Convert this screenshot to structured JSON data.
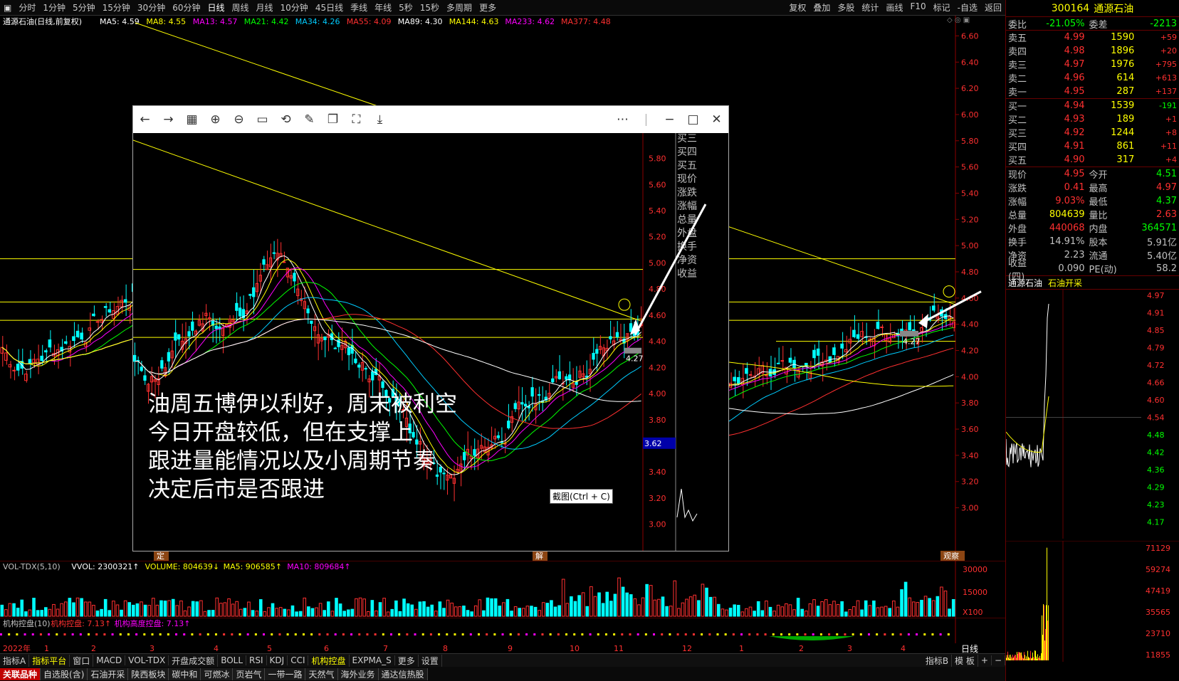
{
  "toolbar": {
    "periods": [
      "分时",
      "1分钟",
      "5分钟",
      "15分钟",
      "30分钟",
      "60分钟",
      "日线",
      "周线",
      "月线",
      "10分钟",
      "45日线",
      "季线",
      "年线",
      "5秒",
      "15秒",
      "多周期",
      "更多"
    ],
    "active": "日线",
    "right": [
      "复权",
      "叠加",
      "多股",
      "统计",
      "画线",
      "F10",
      "标记",
      "-自选",
      "返回"
    ]
  },
  "chart": {
    "title": "通源石油(日线,前复权)",
    "mas": [
      {
        "t": "MA5: 4.59",
        "c": "#ffffff"
      },
      {
        "t": "MA8: 4.55",
        "c": "#ffff00"
      },
      {
        "t": "MA13: 4.57",
        "c": "#ff00ff"
      },
      {
        "t": "MA21: 4.42",
        "c": "#00ff00"
      },
      {
        "t": "MA34: 4.26",
        "c": "#00ccff"
      },
      {
        "t": "MA55: 4.09",
        "c": "#ff3030"
      },
      {
        "t": "MA89: 4.30",
        "c": "#ffffff"
      },
      {
        "t": "MA144: 4.63",
        "c": "#ffff00"
      },
      {
        "t": "MA233: 4.62",
        "c": "#ff00ff"
      },
      {
        "t": "MA377: 4.48",
        "c": "#ff3030"
      }
    ],
    "yticks": [
      "6.60",
      "6.40",
      "6.20",
      "6.00",
      "5.80",
      "5.60",
      "5.40",
      "5.20",
      "5.00",
      "4.80",
      "4.60",
      "4.40",
      "4.20",
      "4.00",
      "3.80",
      "3.60",
      "3.40",
      "3.20",
      "3.00"
    ],
    "last_label": "4.27",
    "markers": [
      "定",
      "解",
      "观察"
    ]
  },
  "overlay": {
    "yticks": [
      "5.80",
      "5.60",
      "5.40",
      "5.20",
      "5.00",
      "4.80",
      "4.60",
      "4.40",
      "4.20",
      "4.00",
      "3.80",
      "3.60",
      "3.40",
      "3.20",
      "3.00"
    ],
    "side_labels": [
      "买三",
      "买四",
      "买五",
      "现价",
      "涨跌",
      "涨幅",
      "总量",
      "外盘",
      "换手",
      "净资",
      "收益"
    ],
    "cursor_price": "3.62",
    "last_label": "4.27",
    "tooltip": "截图(Ctrl + C)",
    "note": [
      "油周五博伊以利好，周末被利空",
      "今日开盘较低，但在支撑上",
      "跟进量能情况以及小周期节奏",
      "决定后市是否跟进"
    ]
  },
  "volume": {
    "header": [
      {
        "t": "VOL-TDX(5,10)",
        "c": "#c0c0c0"
      },
      {
        "t": "VVOL: 2300321↑",
        "c": "#ffffff"
      },
      {
        "t": "VOLUME: 804639↓",
        "c": "#ffff00"
      },
      {
        "t": "MA5: 906585↑",
        "c": "#ffff00"
      },
      {
        "t": "MA10: 809684↑",
        "c": "#ff00ff"
      }
    ],
    "yticks": [
      "30000",
      "15000",
      "X100"
    ]
  },
  "control": {
    "header": [
      {
        "t": "机构控盘(10)",
        "c": "#c0c0c0"
      },
      {
        "t": "机构控盘: 7.13↑",
        "c": "#ff3030"
      },
      {
        "t": "机构高度控盘: 7.13↑",
        "c": "#ff00ff"
      }
    ]
  },
  "dates": [
    "2022年",
    "1",
    "2",
    "3",
    "4",
    "5",
    "6",
    "7",
    "8",
    "9",
    "10",
    "11",
    "12",
    "1",
    "2",
    "3",
    "4"
  ],
  "tabs": [
    "指标A",
    "指标平台",
    "窗口",
    "MACD",
    "VOL-TDX",
    "开盘成交额",
    "BOLL",
    "RSI",
    "KDJ",
    "CCI",
    "机构控盘",
    "EXPMA_S",
    "更多",
    "设置"
  ],
  "tabs_right": [
    "指标B",
    "模 板",
    "+",
    "−"
  ],
  "period_label": "日线",
  "blocks": [
    "关联品种",
    "自选股(含)",
    "石油开采",
    "陕西板块",
    "碳中和",
    "可燃冰",
    "页岩气",
    "一带一路",
    "天然气",
    "海外业务",
    "通达信热股"
  ],
  "quote": {
    "code": "300164",
    "name": "通源石油",
    "weibi": "-21.05%",
    "weicha": "-2213",
    "sells": [
      [
        "卖五",
        "4.99",
        "1590",
        "+59"
      ],
      [
        "卖四",
        "4.98",
        "1896",
        "+20"
      ],
      [
        "卖三",
        "4.97",
        "1976",
        "+795"
      ],
      [
        "卖二",
        "4.96",
        "614",
        "+613"
      ],
      [
        "卖一",
        "4.95",
        "287",
        "+137"
      ]
    ],
    "buys": [
      [
        "买一",
        "4.94",
        "1539",
        "-191"
      ],
      [
        "买二",
        "4.93",
        "189",
        "+1"
      ],
      [
        "买三",
        "4.92",
        "1244",
        "+8"
      ],
      [
        "买四",
        "4.91",
        "861",
        "+11"
      ],
      [
        "买五",
        "4.90",
        "317",
        "+4"
      ]
    ],
    "stats": [
      [
        "现价",
        "4.95",
        "今开",
        "4.51"
      ],
      [
        "涨跌",
        "0.41",
        "最高",
        "4.97"
      ],
      [
        "涨幅",
        "9.03%",
        "最低",
        "4.37"
      ],
      [
        "总量",
        "804639",
        "量比",
        "2.63"
      ],
      [
        "外盘",
        "440068",
        "内盘",
        "364571"
      ],
      [
        "换手",
        "14.91%",
        "股本",
        "5.91亿"
      ],
      [
        "净资",
        "2.23",
        "流通",
        "5.40亿"
      ],
      [
        "收益(四)",
        "0.090",
        "PE(动)",
        "58.2"
      ]
    ],
    "tline_title": [
      "通源石油",
      "石油开采"
    ],
    "tline_yticks": [
      "4.97",
      "4.91",
      "4.85",
      "4.79",
      "4.72",
      "4.66",
      "4.60",
      "4.54",
      "4.48",
      "4.42",
      "4.36",
      "4.29",
      "4.23",
      "4.17"
    ],
    "tvol_yticks": [
      "71129",
      "59274",
      "47419",
      "35565",
      "23710",
      "11855"
    ]
  }
}
